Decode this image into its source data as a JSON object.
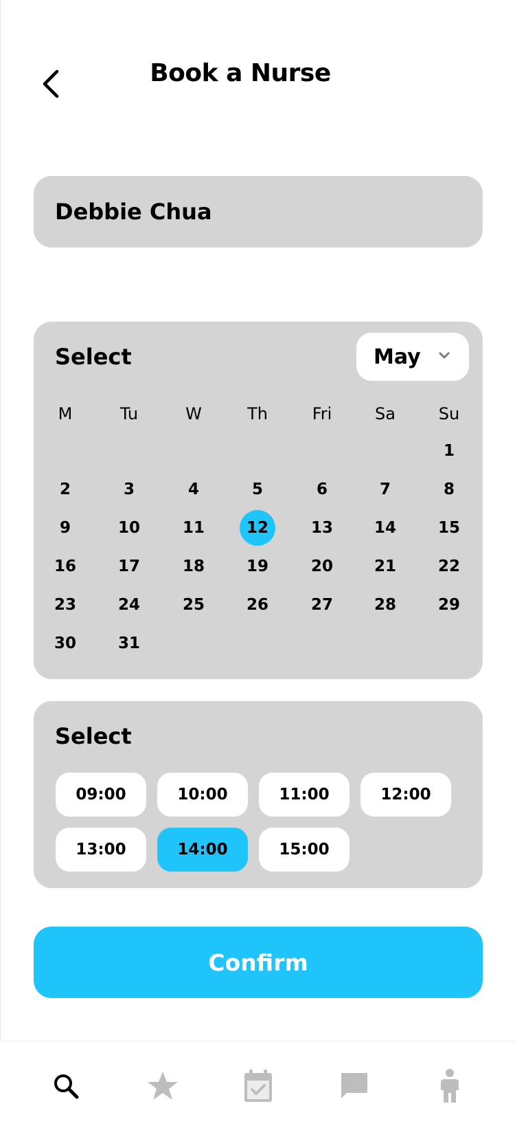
{
  "header": {
    "title": "Book a Nurse",
    "back_icon": "chevron-left-icon"
  },
  "patient": {
    "name": "Debbie Chua"
  },
  "calendar": {
    "label": "Select",
    "month": "May",
    "weekdays": [
      "M",
      "Tu",
      "W",
      "Th",
      "Fri",
      "Sa",
      "Su"
    ],
    "rows": [
      [
        "",
        "",
        "",
        "",
        "",
        "",
        "1"
      ],
      [
        "2",
        "3",
        "4",
        "5",
        "6",
        "7",
        "8"
      ],
      [
        "9",
        "10",
        "11",
        "12",
        "13",
        "14",
        "15"
      ],
      [
        "16",
        "17",
        "18",
        "19",
        "20",
        "21",
        "22"
      ],
      [
        "23",
        "24",
        "25",
        "26",
        "27",
        "28",
        "29"
      ],
      [
        "30",
        "31",
        "",
        "",
        "",
        "",
        ""
      ]
    ],
    "selected_day": "12"
  },
  "time": {
    "label": "Select",
    "slots": [
      "09:00",
      "10:00",
      "11:00",
      "12:00",
      "13:00",
      "14:00",
      "15:00"
    ],
    "selected_slot": "14:00"
  },
  "confirm_label": "Confirm",
  "nav": {
    "items": [
      "search-icon",
      "star-icon",
      "calendar-check-icon",
      "chat-icon",
      "person-icon"
    ],
    "active": "search-icon"
  },
  "colors": {
    "accent": "#1fc4fb",
    "card": "#d4d4d4",
    "nav_inactive": "#bdbdbd",
    "nav_active": "#000000"
  }
}
